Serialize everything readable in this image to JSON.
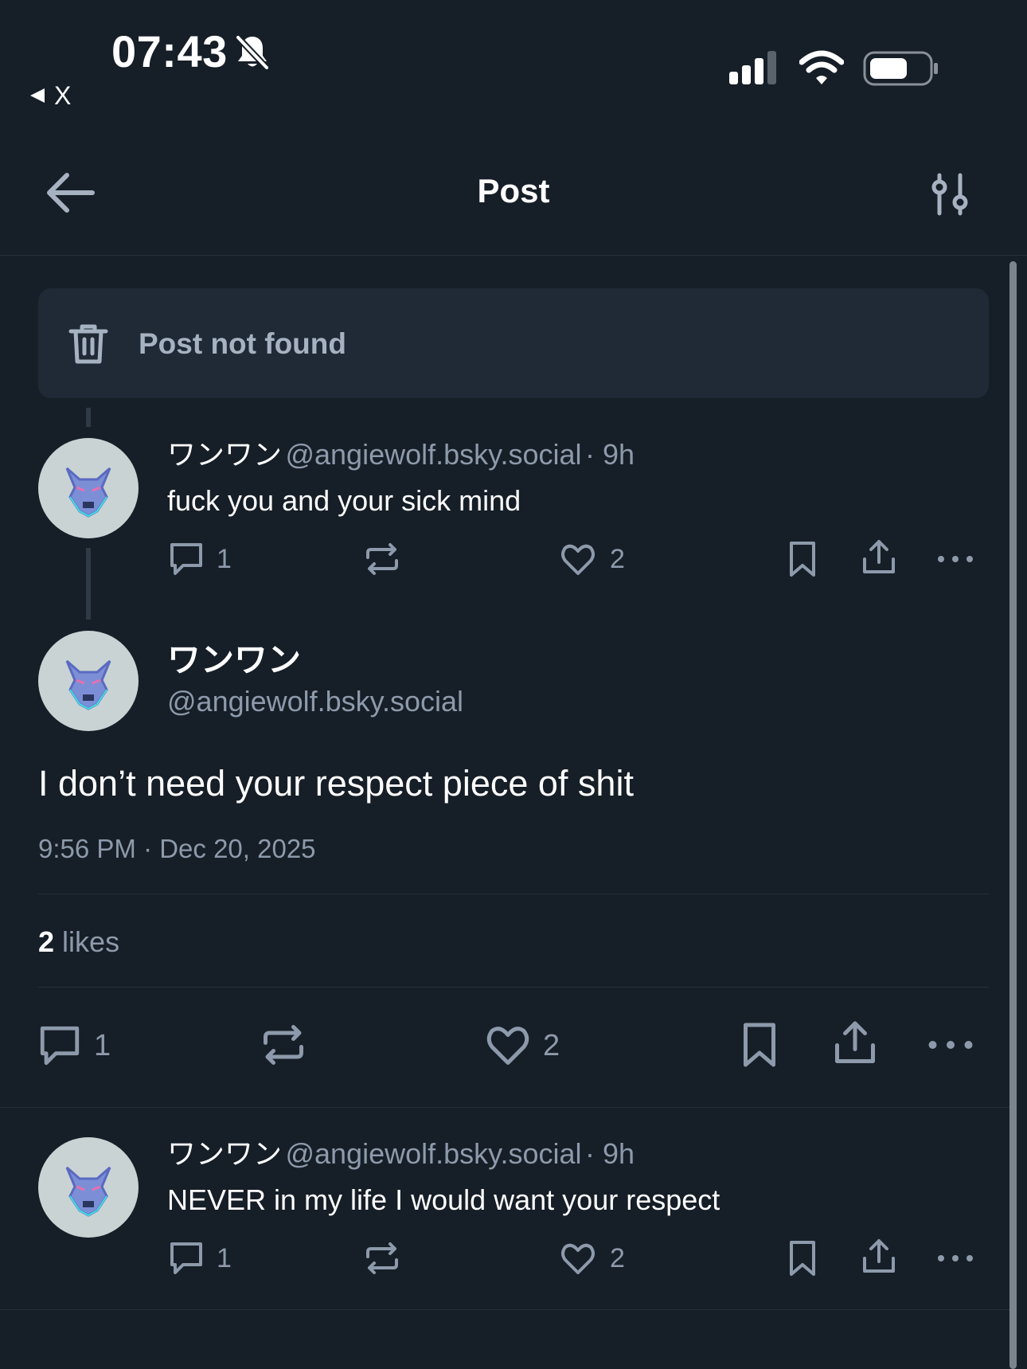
{
  "status_bar": {
    "time": "07:43",
    "back_app": "X"
  },
  "header": {
    "title": "Post"
  },
  "not_found": {
    "text": "Post not found"
  },
  "parent_post": {
    "author_name": "ワンワン",
    "author_handle": "@angiewolf.bsky.social",
    "time": "· 9h",
    "text": "fuck you and your sick mind",
    "reply_count": "1",
    "like_count": "2"
  },
  "main_post": {
    "author_name": "ワンワン",
    "author_handle": "@angiewolf.bsky.social",
    "text": "I don’t need your respect piece of shit",
    "timestamp": "9:56 PM · Dec 20, 2025",
    "likes_number": "2",
    "likes_label": "likes",
    "reply_count": "1",
    "like_count": "2"
  },
  "reply_post": {
    "author_name": "ワンワン",
    "author_handle": "@angiewolf.bsky.social",
    "time": "· 9h",
    "text": "NEVER in my life I would want your respect",
    "reply_count": "1",
    "like_count": "2"
  },
  "colors": {
    "background": "#161e27",
    "card": "#1f2a36",
    "muted_text": "#8d9aab",
    "divider": "#26303c"
  }
}
